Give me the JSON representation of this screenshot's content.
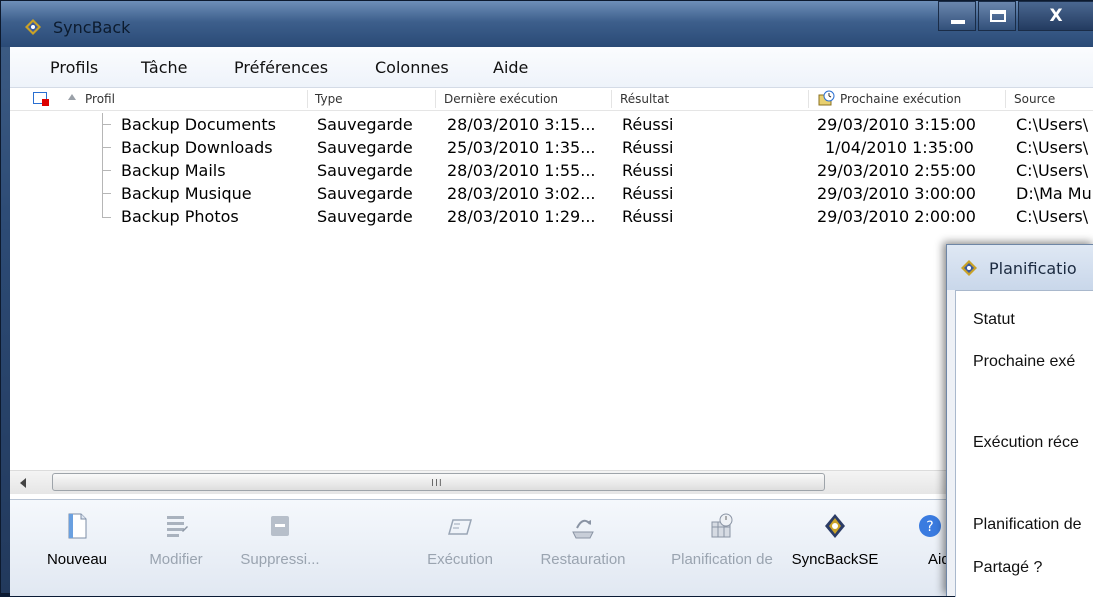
{
  "window": {
    "title": "SyncBack"
  },
  "menu": [
    "Profils",
    "Tâche",
    "Préférences",
    "Colonnes",
    "Aide"
  ],
  "columns": {
    "profil": "Profil",
    "type": "Type",
    "derniere": "Dernière exécution",
    "resultat": "Résultat",
    "prochaine": "Prochaine exécution",
    "source": "Source"
  },
  "rows": [
    {
      "profil": "Backup Documents",
      "type": "Sauvegarde",
      "derniere": "28/03/2010 3:15...",
      "resultat": "Réussi",
      "prochaine": "29/03/2010 3:15:00",
      "source": "C:\\Users\\"
    },
    {
      "profil": "Backup Downloads",
      "type": "Sauvegarde",
      "derniere": "25/03/2010 1:35...",
      "resultat": "Réussi",
      "prochaine": "1/04/2010 1:35:00",
      "source": "C:\\Users\\"
    },
    {
      "profil": "Backup Mails",
      "type": "Sauvegarde",
      "derniere": "28/03/2010 1:55...",
      "resultat": "Réussi",
      "prochaine": "29/03/2010 2:55:00",
      "source": "C:\\Users\\"
    },
    {
      "profil": "Backup Musique",
      "type": "Sauvegarde",
      "derniere": "28/03/2010 3:02...",
      "resultat": "Réussi",
      "prochaine": "29/03/2010 3:00:00",
      "source": "D:\\Ma Mu"
    },
    {
      "profil": "Backup Photos",
      "type": "Sauvegarde",
      "derniere": "28/03/2010 1:29...",
      "resultat": "Réussi",
      "prochaine": "29/03/2010 2:00:00",
      "source": "C:\\Users\\"
    }
  ],
  "scrollbar": {
    "grip": "III"
  },
  "toolbar": {
    "nouveau": "Nouveau",
    "modifier": "Modifier",
    "suppression": "Suppressi...",
    "execution": "Exécution",
    "restauration": "Restauration",
    "planification": "Planification de",
    "syncbackse": "SyncBackSE",
    "aide": "Aid"
  },
  "dialog": {
    "title": "Planificatio",
    "statut": "Statut",
    "prochaine": "Prochaine exé",
    "recente": "Exécution réce",
    "planification": "Planification de",
    "partage": "Partagé ?"
  },
  "colors": {
    "accent": "#2a6fd1",
    "disabled_text": "#9aa4b0"
  }
}
